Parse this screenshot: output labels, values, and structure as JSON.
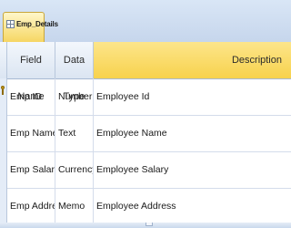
{
  "tab": {
    "label": "Emp_Details"
  },
  "columns": {
    "field_name": "Field Name",
    "data_type": "Data Type",
    "description": "Description"
  },
  "rows": [
    {
      "field": "Emp ID",
      "type": "Number",
      "description": "Employee Id",
      "primary_key": true
    },
    {
      "field": "Emp Name",
      "type": "Text",
      "description": "Employee Name",
      "primary_key": false
    },
    {
      "field": "Emp Salary",
      "type": "Currency",
      "description": "Employee Salary",
      "primary_key": false
    },
    {
      "field": "Emp Address",
      "type": "Memo",
      "description": "Employee Address",
      "primary_key": false
    }
  ],
  "colors": {
    "tab_active": "#f6d663",
    "header_highlight": "#f7d24d",
    "frame": "#c9d8ec"
  }
}
